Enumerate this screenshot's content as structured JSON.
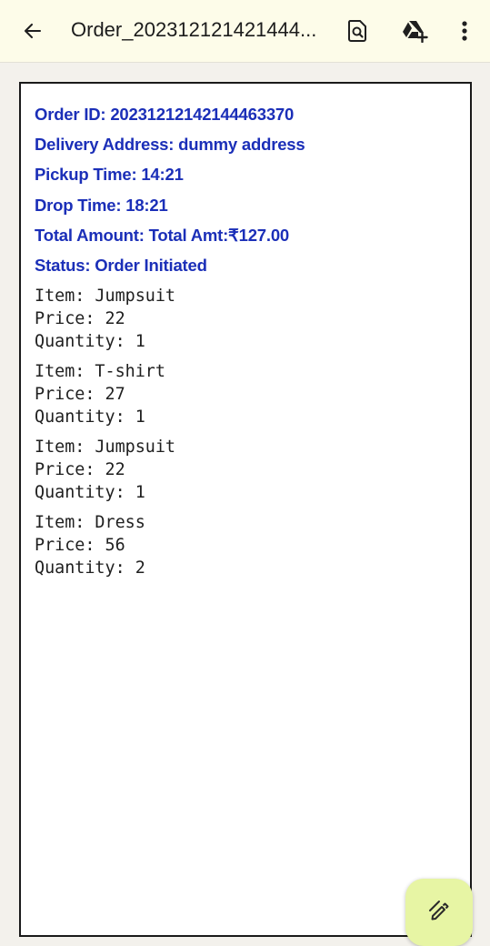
{
  "app_bar": {
    "title": "Order_202312121421444...",
    "back_icon": "arrow-left-icon",
    "search_icon": "find-in-document-icon",
    "drive_icon": "add-to-drive-icon",
    "more_icon": "more-vertical-icon",
    "background_color": "#fdfce9"
  },
  "document": {
    "header_lines": [
      "Order ID: 20231212142144463370",
      "Delivery Address: dummy address",
      "Pickup Time: 14:21",
      "Drop Time: 18:21",
      "Total Amount: Total Amt:₹127.00",
      "Status: Order Initiated"
    ],
    "header_color": "#1b2fb8",
    "items": [
      {
        "item": "Item: Jumpsuit",
        "price": "Price: 22",
        "quantity": "Quantity: 1"
      },
      {
        "item": "Item: T-shirt",
        "price": "Price: 27",
        "quantity": "Quantity: 1"
      },
      {
        "item": "Item: Jumpsuit",
        "price": "Price: 22",
        "quantity": "Quantity: 1"
      },
      {
        "item": "Item: Dress",
        "price": "Price: 56",
        "quantity": "Quantity: 2"
      }
    ]
  },
  "fab": {
    "icon": "annotate-pen-icon",
    "background_color": "#e7f5a4"
  }
}
